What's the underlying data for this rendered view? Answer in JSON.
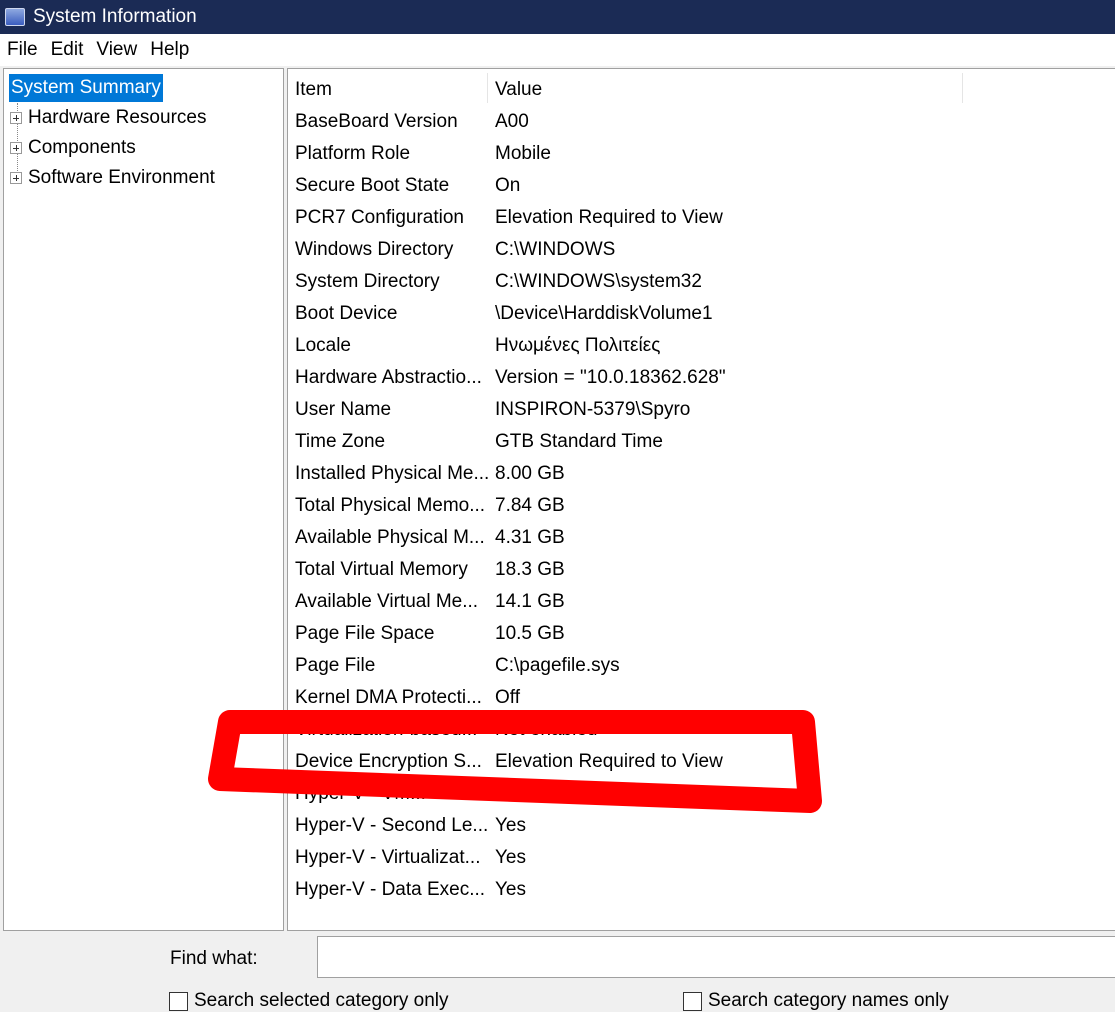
{
  "window": {
    "title": "System Information"
  },
  "menu": [
    "File",
    "Edit",
    "View",
    "Help"
  ],
  "tree": {
    "selected": "System Summary",
    "items": [
      "Hardware Resources",
      "Components",
      "Software Environment"
    ]
  },
  "table": {
    "headers": [
      "Item",
      "Value"
    ],
    "rows": [
      [
        "BaseBoard Version",
        "A00"
      ],
      [
        "Platform Role",
        "Mobile"
      ],
      [
        "Secure Boot State",
        "On"
      ],
      [
        "PCR7 Configuration",
        "Elevation Required to View"
      ],
      [
        "Windows Directory",
        "C:\\WINDOWS"
      ],
      [
        "System Directory",
        "C:\\WINDOWS\\system32"
      ],
      [
        "Boot Device",
        "\\Device\\HarddiskVolume1"
      ],
      [
        "Locale",
        "Ηνωμένες Πολιτείες"
      ],
      [
        "Hardware Abstractio...",
        "Version = \"10.0.18362.628\""
      ],
      [
        "User Name",
        "INSPIRON-5379\\Spyro"
      ],
      [
        "Time Zone",
        "GTB Standard Time"
      ],
      [
        "Installed Physical Me...",
        "8.00 GB"
      ],
      [
        "Total Physical Memo...",
        "7.84 GB"
      ],
      [
        "Available Physical M...",
        "4.31 GB"
      ],
      [
        "Total Virtual Memory",
        "18.3 GB"
      ],
      [
        "Available Virtual Me...",
        "14.1 GB"
      ],
      [
        "Page File Space",
        "10.5 GB"
      ],
      [
        "Page File",
        "C:\\pagefile.sys"
      ],
      [
        "Kernel DMA Protecti...",
        "Off"
      ],
      [
        "Virtualization-based...",
        "Not enabled"
      ],
      [
        "Device Encryption S...",
        "Elevation Required to View"
      ],
      [
        "Hyper-V - VM...",
        ""
      ],
      [
        "Hyper-V - Second Le...",
        "Yes"
      ],
      [
        "Hyper-V - Virtualizat...",
        "Yes"
      ],
      [
        "Hyper-V - Data Exec...",
        "Yes"
      ]
    ]
  },
  "find": {
    "label": "Find what:",
    "value": ""
  },
  "checkboxes": [
    {
      "label": "Search selected category only",
      "checked": false
    },
    {
      "label": "Search category names only",
      "checked": false
    }
  ],
  "annotation": {
    "color": "#ff0000"
  }
}
